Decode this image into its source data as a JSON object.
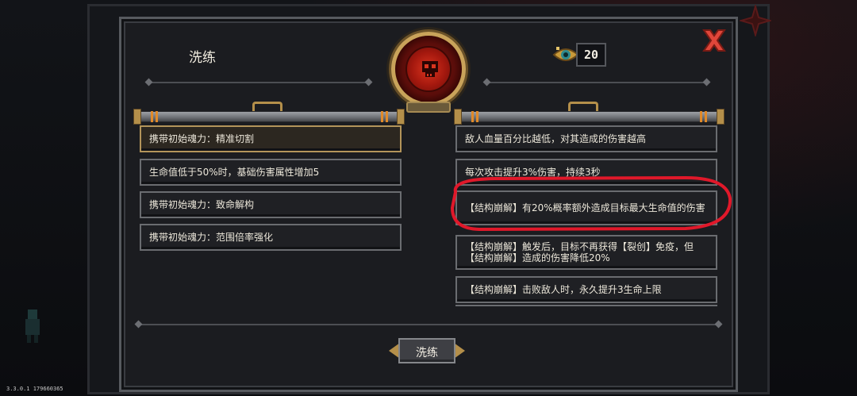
{
  "panel": {
    "title": "洗练"
  },
  "currency": {
    "icon": "eye-gem-icon",
    "value": "20"
  },
  "left_options": [
    {
      "label": "携带初始魂力：精准切割",
      "selected": true
    },
    {
      "label": "生命值低于50%时，基础伤害属性增加5",
      "selected": false
    },
    {
      "label": "携带初始魂力：致命解构",
      "selected": false
    },
    {
      "label": "携带初始魂力：范围倍率强化",
      "selected": false
    }
  ],
  "right_options": [
    {
      "label": "敌人血量百分比越低，对其造成的伤害越高"
    },
    {
      "label": "每次攻击提升3%伤害，持续3秒"
    },
    {
      "label": "【结构崩解】有20%概率额外造成目标最大生命值的伤害"
    },
    {
      "label": "【结构崩解】触发后，目标不再获得【裂创】免疫，但【结构崩解】造成的伤害降低20%"
    },
    {
      "label": "【结构崩解】击败敌人时，永久提升3生命上限"
    }
  ],
  "reforge_button": {
    "label": "洗练"
  },
  "version": "3.3.0.1 179660365",
  "colors": {
    "accent_gold": "#b48f4a",
    "emblem_red": "#d9351f",
    "highlight_ring": "#e0182a",
    "close_red": "#e0463a"
  }
}
